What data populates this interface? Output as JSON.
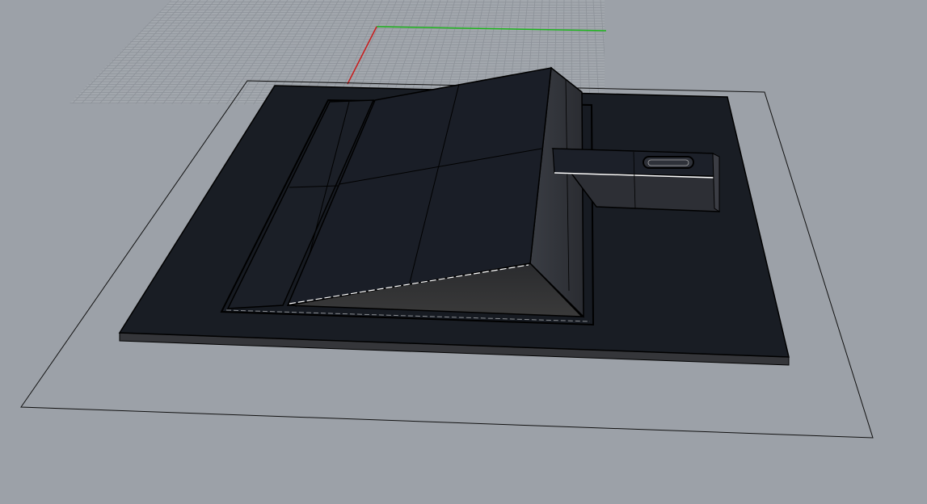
{
  "viewport": {
    "projection": "perspective",
    "background_color": "#9ca1a8",
    "grid_color": "#8f949c",
    "x_axis_color": "#d01818",
    "y_axis_color": "#18b818",
    "object_color": "#191d24",
    "object_edge_color": "#000000",
    "highlight_color": "#ffffff",
    "outline_color": "#111111"
  }
}
